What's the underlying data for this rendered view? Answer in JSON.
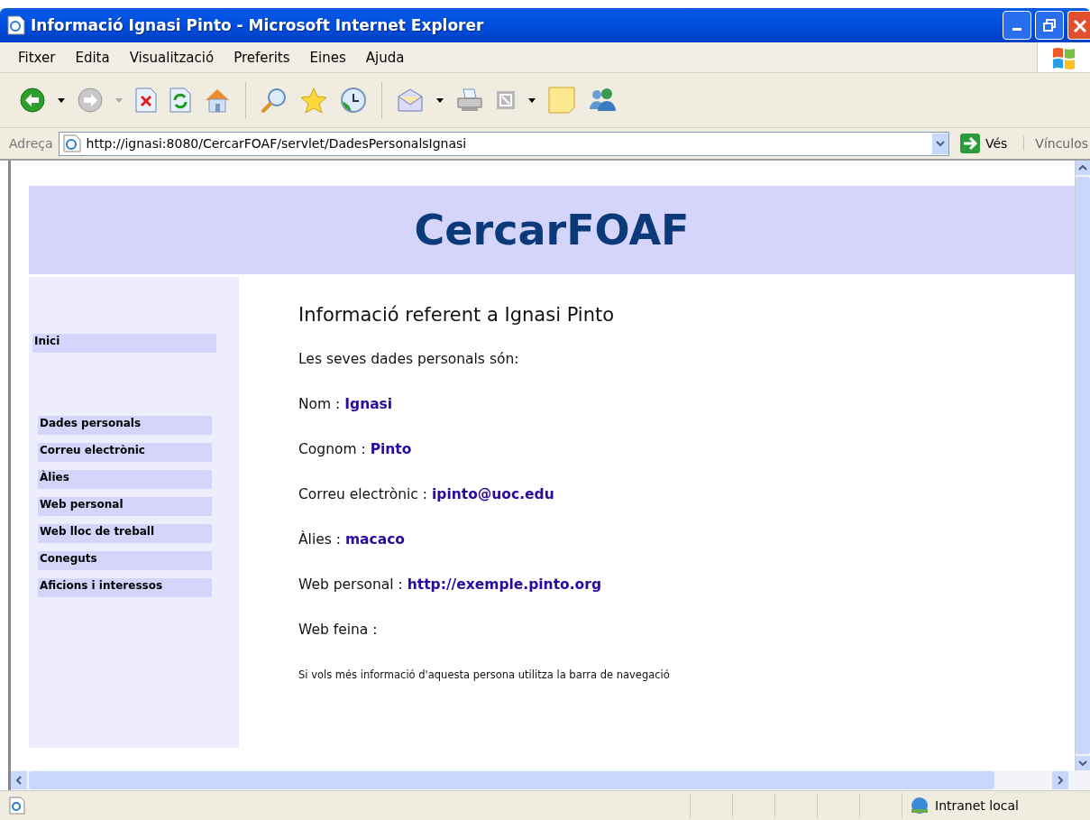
{
  "window": {
    "title": "Informació Ignasi Pinto - Microsoft Internet Explorer"
  },
  "menu": [
    "Fitxer",
    "Edita",
    "Visualització",
    "Preferits",
    "Eines",
    "Ajuda"
  ],
  "address": {
    "label": "Adreça",
    "value": "http://ignasi:8080/CercarFOAF/servlet/DadesPersonalsIgnasi",
    "go": "Vés",
    "links": "Vínculos"
  },
  "page": {
    "banner": "CercarFOAF",
    "home_link": "Inici",
    "nav": [
      "Dades personals",
      "Correu electrònic",
      "Àlies",
      "Web personal",
      "Web lloc de treball",
      "Coneguts",
      "Aficions i interessos"
    ],
    "heading": "Informació referent a Ignasi Pinto",
    "intro": "Les seves dades personals són:",
    "fields": [
      {
        "label": "Nom :",
        "value": "Ignasi"
      },
      {
        "label": "Cognom :",
        "value": "Pinto"
      },
      {
        "label": "Correu electrònic :",
        "value": "ipinto@uoc.edu"
      },
      {
        "label": "Àlies :",
        "value": "macaco"
      },
      {
        "label": "Web personal :",
        "value": "http://exemple.pinto.org"
      },
      {
        "label": "Web feina :"
      }
    ],
    "note": "Si vols més informació d'aquesta persona utilitza la barra de navegació"
  },
  "status_bar": {
    "zone": "Intranet local"
  }
}
